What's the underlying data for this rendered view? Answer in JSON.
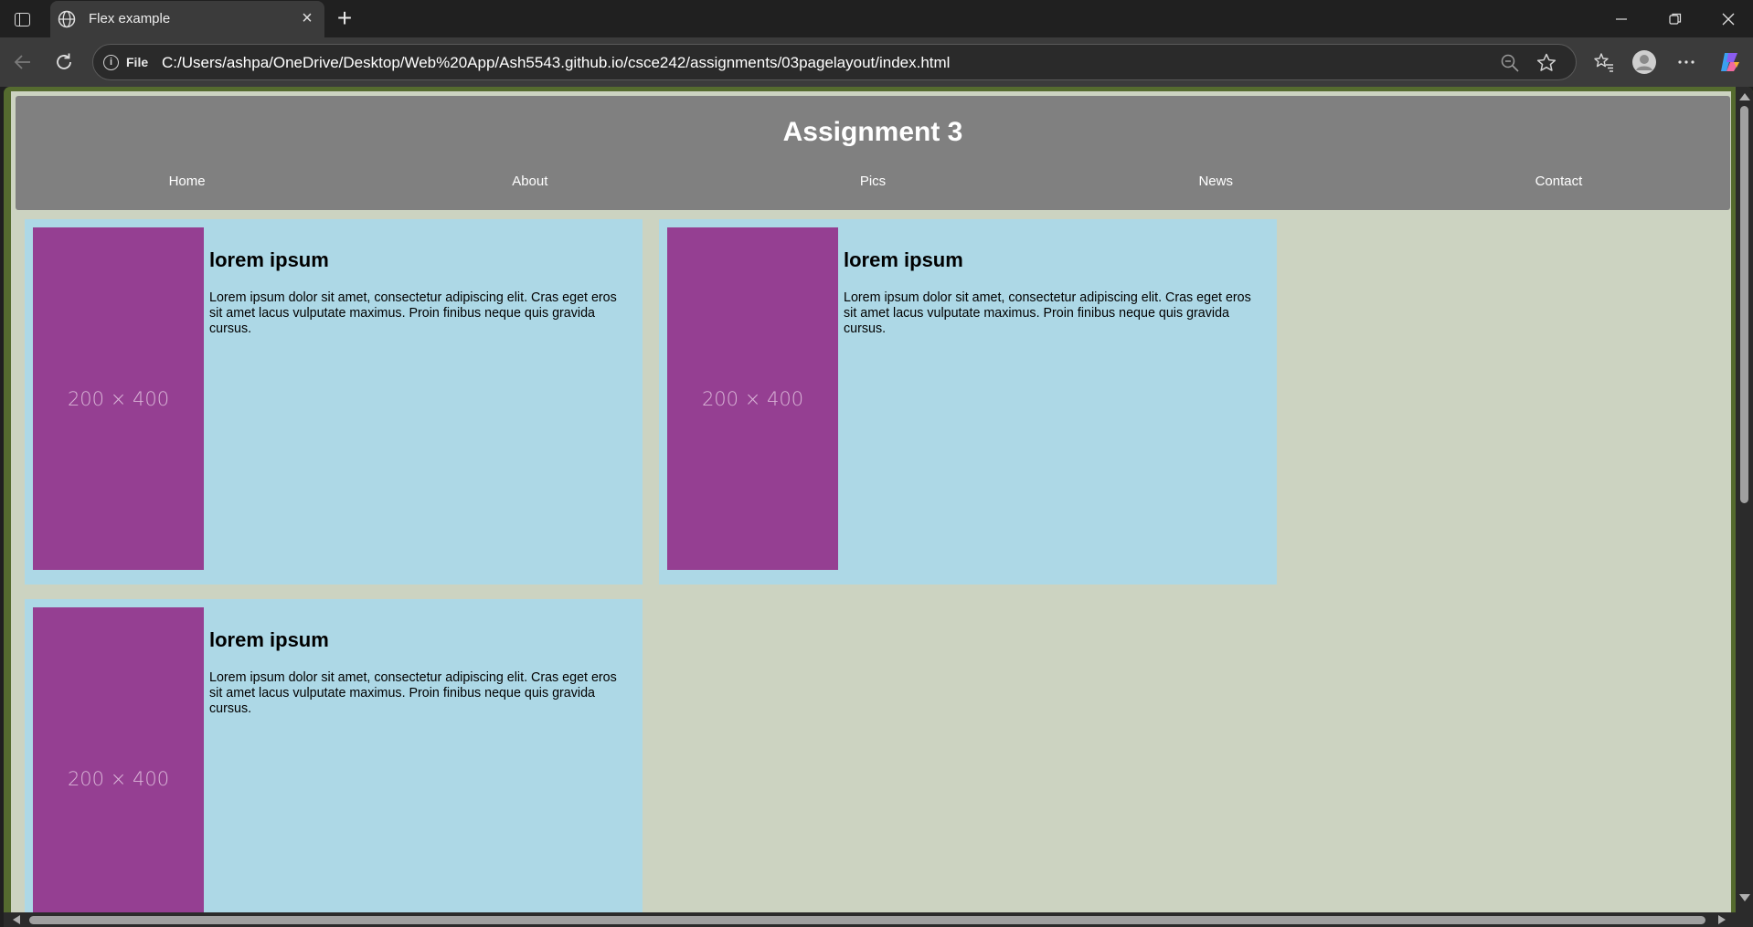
{
  "browser": {
    "tab_title": "Flex example",
    "new_tab_label": "+",
    "close_tab_label": "×",
    "address_protocol": "File",
    "url": "C:/Users/ashpa/OneDrive/Desktop/Web%20App/Ash5543.github.io/csce242/assignments/03pagelayout/index.html"
  },
  "page": {
    "title": "Assignment 3",
    "nav": [
      "Home",
      "About",
      "Pics",
      "News",
      "Contact"
    ],
    "cards": [
      {
        "image_label": "200 × 400",
        "heading": "lorem ipsum",
        "text": "Lorem ipsum dolor sit amet, consectetur adipiscing elit. Cras eget eros sit amet lacus vulputate maximus. Proin finibus neque quis gravida cursus."
      },
      {
        "image_label": "200 × 400",
        "heading": "lorem ipsum",
        "text": "Lorem ipsum dolor sit amet, consectetur adipiscing elit. Cras eget eros sit amet lacus vulputate maximus. Proin finibus neque quis gravida cursus."
      },
      {
        "image_label": "200 × 400",
        "heading": "lorem ipsum",
        "text": "Lorem ipsum dolor sit amet, consectetur adipiscing elit. Cras eget eros sit amet lacus vulputate maximus. Proin finibus neque quis gravida cursus."
      }
    ]
  },
  "colors": {
    "header_bg": "#808080",
    "page_bg": "#ccd3c1",
    "card_bg": "#add8e6",
    "image_bg": "#953f92",
    "frame_border": "#556b2f"
  }
}
